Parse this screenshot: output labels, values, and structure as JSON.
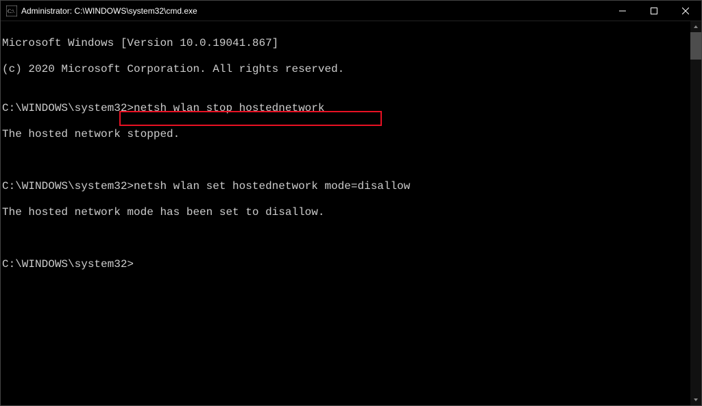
{
  "titlebar": {
    "title": "Administrator: C:\\WINDOWS\\system32\\cmd.exe"
  },
  "terminal": {
    "version_line": "Microsoft Windows [Version 10.0.19041.867]",
    "copyright_line": "(c) 2020 Microsoft Corporation. All rights reserved.",
    "blank": "",
    "prompt1_prefix": "C:\\WINDOWS\\system32>",
    "cmd1": "netsh wlan stop hostednetwork",
    "out1": "The hosted network stopped.",
    "prompt2_prefix": "C:\\WINDOWS\\system32>",
    "cmd2": "netsh wlan set hostednetwork mode=disallow",
    "out2": "The hosted network mode has been set to disallow.",
    "prompt3_prefix": "C:\\WINDOWS\\system32>"
  }
}
